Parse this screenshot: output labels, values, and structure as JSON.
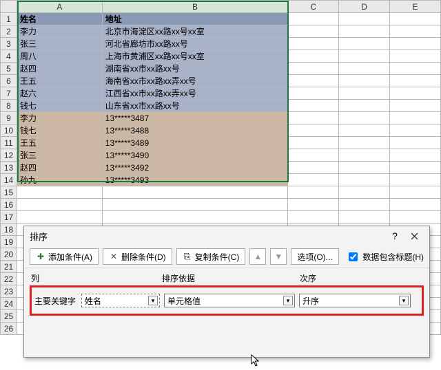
{
  "columns": [
    "A",
    "B",
    "C",
    "D",
    "E"
  ],
  "sheet": {
    "header": {
      "name": "姓名",
      "addr": "地址"
    },
    "rows": [
      {
        "n": 2,
        "name": "李力",
        "val": "北京市海淀区xx路xx号xx室",
        "cls": "grp1"
      },
      {
        "n": 3,
        "name": "张三",
        "val": "河北省廊坊市xx路xx号",
        "cls": "grp1"
      },
      {
        "n": 4,
        "name": "周八",
        "val": "上海市黄浦区xx路xx号xx室",
        "cls": "grp1"
      },
      {
        "n": 5,
        "name": "赵四",
        "val": "湖南省xx市xx路xx号",
        "cls": "grp1"
      },
      {
        "n": 6,
        "name": "王五",
        "val": "海南省xx市xx路xx弄xx号",
        "cls": "grp1"
      },
      {
        "n": 7,
        "name": "赵六",
        "val": "江西省xx市xx路xx弄xx号",
        "cls": "grp1"
      },
      {
        "n": 8,
        "name": "钱七",
        "val": "山东省xx市xx路xx号",
        "cls": "grp1"
      },
      {
        "n": 9,
        "name": "李力",
        "val": "13*****3487",
        "cls": "grp2"
      },
      {
        "n": 10,
        "name": "钱七",
        "val": "13*****3488",
        "cls": "grp2"
      },
      {
        "n": 11,
        "name": "王五",
        "val": "13*****3489",
        "cls": "grp2"
      },
      {
        "n": 12,
        "name": "张三",
        "val": "13*****3490",
        "cls": "grp2"
      },
      {
        "n": 13,
        "name": "赵四",
        "val": "13*****3492",
        "cls": "grp2"
      },
      {
        "n": 14,
        "name": "孙九",
        "val": "13*****3493",
        "cls": "grp2"
      }
    ],
    "empty_rows": [
      15,
      16,
      17,
      18,
      19,
      20,
      21,
      22,
      23,
      24,
      25,
      26
    ]
  },
  "dialog": {
    "title": "排序",
    "help": "?",
    "toolbar": {
      "add": "添加条件(A)",
      "delete": "删除条件(D)",
      "copy": "复制条件(C)",
      "options": "选项(O)...",
      "header_checkbox": "数据包含标题(H)",
      "header_checked": true
    },
    "grid": {
      "col1": "列",
      "col2": "排序依据",
      "col3": "次序",
      "row": {
        "label": "主要关键字",
        "key": "姓名",
        "basis": "单元格值",
        "order": "升序"
      }
    }
  },
  "chart_data": {
    "type": "table",
    "columns": [
      "姓名",
      "地址"
    ],
    "rows": [
      [
        "李力",
        "北京市海淀区xx路xx号xx室"
      ],
      [
        "张三",
        "河北省廊坊市xx路xx号"
      ],
      [
        "周八",
        "上海市黄浦区xx路xx号xx室"
      ],
      [
        "赵四",
        "湖南省xx市xx路xx号"
      ],
      [
        "王五",
        "海南省xx市xx路xx弄xx号"
      ],
      [
        "赵六",
        "江西省xx市xx路xx弄xx号"
      ],
      [
        "钱七",
        "山东省xx市xx路xx号"
      ],
      [
        "李力",
        "13*****3487"
      ],
      [
        "钱七",
        "13*****3488"
      ],
      [
        "王五",
        "13*****3489"
      ],
      [
        "张三",
        "13*****3490"
      ],
      [
        "赵四",
        "13*****3492"
      ],
      [
        "孙九",
        "13*****3493"
      ]
    ]
  }
}
